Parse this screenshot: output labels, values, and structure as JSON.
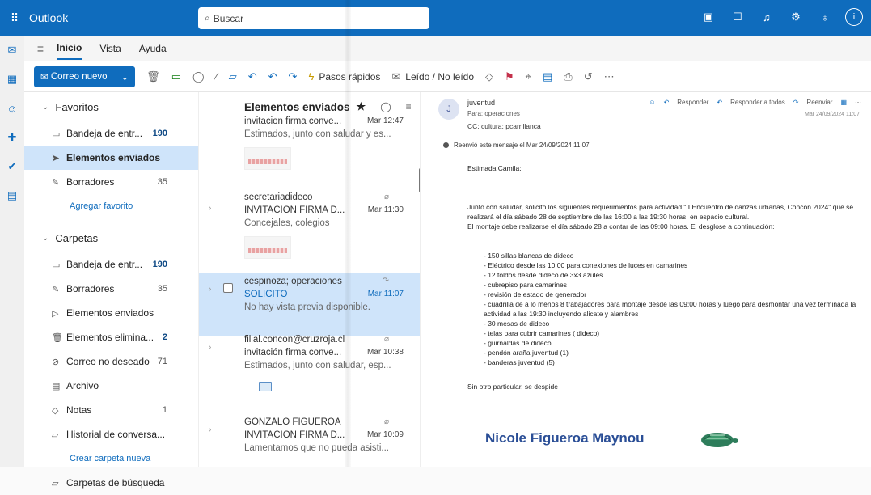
{
  "app": {
    "name": "Outlook"
  },
  "search": {
    "placeholder": "Buscar"
  },
  "menu": {
    "tabs": [
      "Inicio",
      "Vista",
      "Ayuda"
    ]
  },
  "ribbon": {
    "new_mail": "Correo nuevo",
    "quick_steps": "Pasos rápidos",
    "read_unread": "Leído / No leído"
  },
  "folders": {
    "favorites_title": "Favoritos",
    "favorites": [
      {
        "label": "Bandeja de entr...",
        "count": "190"
      },
      {
        "label": "Elementos enviados",
        "count": ""
      },
      {
        "label": "Borradores",
        "count": "35"
      }
    ],
    "add_favorite": "Agregar favorito",
    "folders_title": "Carpetas",
    "items": [
      {
        "label": "Bandeja de entr...",
        "count": "190"
      },
      {
        "label": "Borradores",
        "count": "35"
      },
      {
        "label": "Elementos enviados",
        "count": ""
      },
      {
        "label": "Elementos elimina...",
        "count": "2"
      },
      {
        "label": "Correo no deseado",
        "count": "71"
      },
      {
        "label": "Archivo",
        "count": ""
      },
      {
        "label": "Notas",
        "count": "1"
      },
      {
        "label": "Historial de conversa...",
        "count": ""
      }
    ],
    "create_folder": "Crear carpeta nueva",
    "search_folders": "Carpetas de búsqueda"
  },
  "list": {
    "title": "Elementos enviados",
    "messages": [
      {
        "from": "",
        "subject": "invitacion firma conve...",
        "time": "Mar 12:47",
        "preview": "Estimados, junto con saludar y es..."
      },
      {
        "from": "secretariadideco",
        "subject": "INVITACION FIRMA D...",
        "time": "Mar 11:30",
        "preview": "Concejales, colegios"
      },
      {
        "from": "cespinoza; operaciones",
        "subject": "SOLICITO",
        "time": "Mar 11:07",
        "preview": "No hay vista previa disponible."
      },
      {
        "from": "filial.concon@cruzroja.cl",
        "subject": "invitación firma conve...",
        "time": "Mar 10:38",
        "preview": "Estimados, junto con saludar, esp..."
      },
      {
        "from": "GONZALO FIGUEROA",
        "subject": "INVITACION FIRMA D...",
        "time": "Mar 10:09",
        "preview": "Lamentamos que no pueda asisti..."
      }
    ]
  },
  "reading": {
    "avatar": "J",
    "from": "juventud",
    "to": "Para: operaciones",
    "cc": "CC: cultura; pcarrillanca",
    "reply": "Responder",
    "reply_all": "Responder a todos",
    "forward": "Reenviar",
    "date": "Mar 24/09/2024 11:07",
    "forward_note": "Reenvió este mensaje el Mar 24/09/2024 11:07.",
    "greeting": "Estimada Camila:",
    "para1": "Junto con saludar, solicito los siguientes requerimientos para actividad \" I Encuentro de danzas urbanas, Concón 2024\" que se realizará el día sábado 28 de septiembre de las 16:00 a las 19:30 horas, en espacio cultural.",
    "para2": "El montaje debe realizarse el día sábado 28 a contar de las 09:00 horas.  El desglose a continuación:",
    "items": [
      "- 150 sillas blancas de dideco",
      "- Eléctrico desde las 10:00 para conexiones de luces en camarines",
      "- 12 toldos desde dideco de 3x3 azules.",
      "- cubrepiso para camarines",
      "- revisión de estado de generador",
      "- cuadrilla de a lo menos 8 trabajadores para montaje desde las 09:00 horas y luego para desmontar una vez terminada la actividad a las 19:30 incluyendo alicate y alambres",
      "- 30 mesas de dideco",
      "- telas para cubrir camarines ( dideco)",
      "- guirnaldas de dideco",
      "- pendón araña juventud (1)",
      "- banderas juventud (5)"
    ],
    "closing": "Sin otro particular, se despide",
    "signature": "Nicole Figueroa Maynou"
  }
}
